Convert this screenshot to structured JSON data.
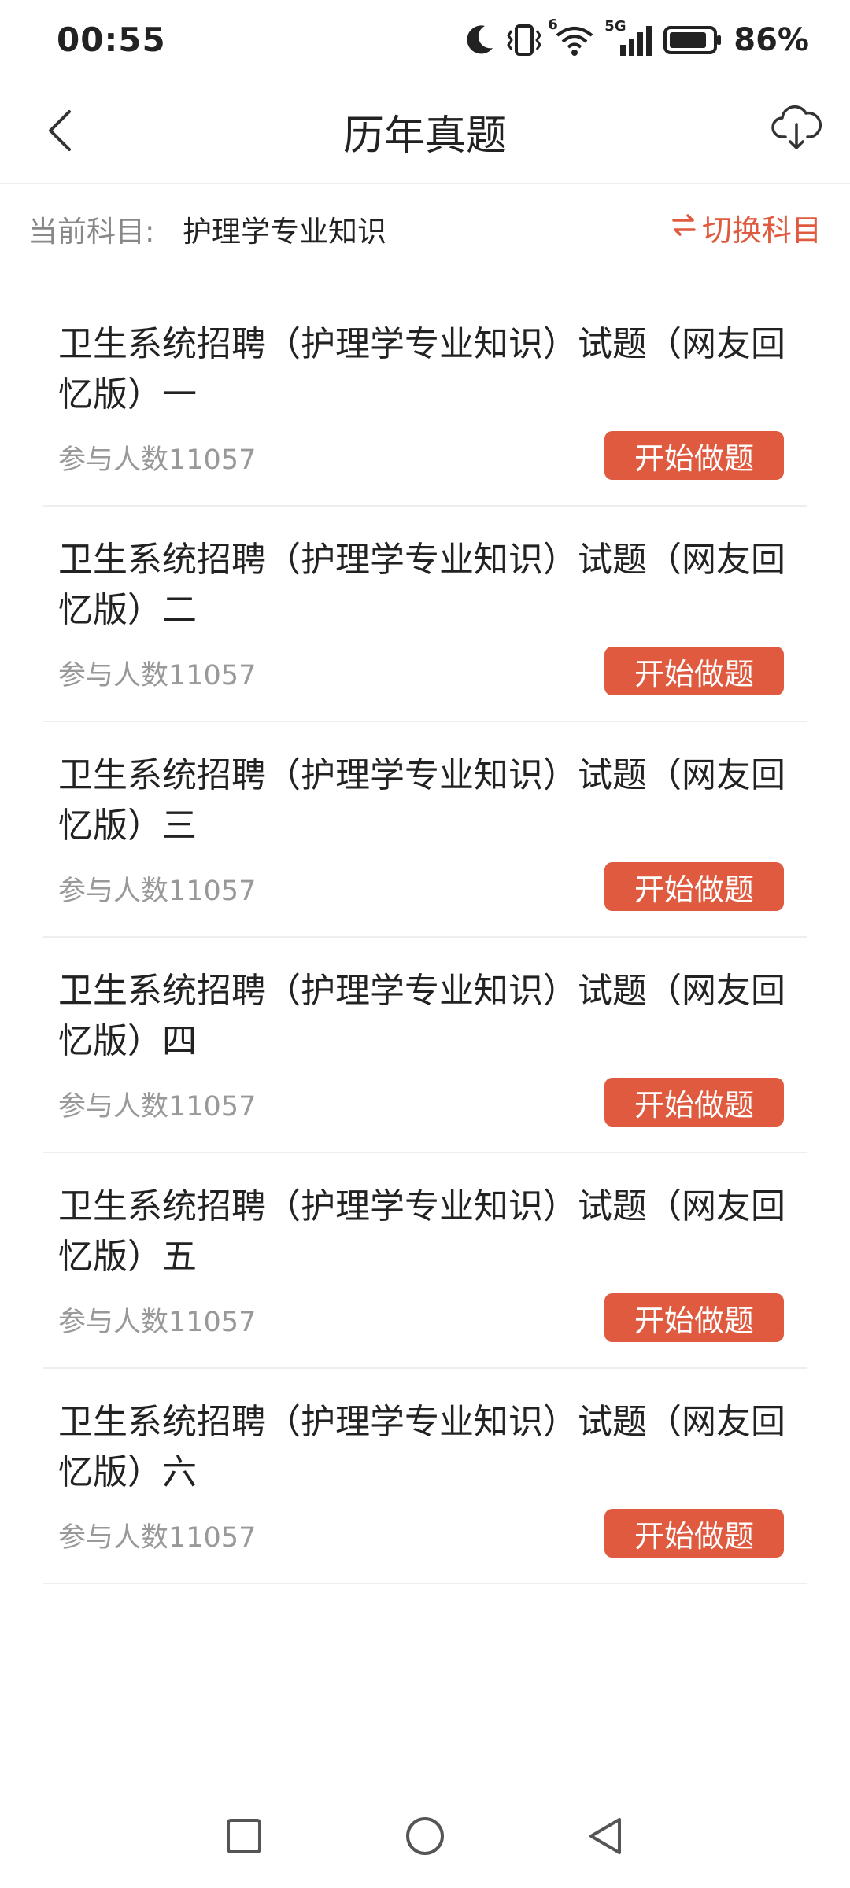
{
  "status_bar": {
    "time": "00:55",
    "battery_percent": "86%",
    "icons": [
      "moon-icon",
      "vibrate-icon",
      "wifi-icon",
      "signal-5g-icon",
      "battery-icon"
    ],
    "wifi_badge": "6",
    "network_badge": "5G"
  },
  "header": {
    "title": "历年真题",
    "back_icon": "chevron-left-icon",
    "download_icon": "cloud-download-icon"
  },
  "subject": {
    "label": "当前科目:",
    "value": "护理学专业知识",
    "switch_label": "切换科目",
    "switch_icon": "swap-arrows-icon"
  },
  "exams": [
    {
      "title": "卫生系统招聘（护理学专业知识）试题（网友回忆版）一",
      "participants": "参与人数11057",
      "button": "开始做题"
    },
    {
      "title": "卫生系统招聘（护理学专业知识）试题（网友回忆版）二",
      "participants": "参与人数11057",
      "button": "开始做题"
    },
    {
      "title": "卫生系统招聘（护理学专业知识）试题（网友回忆版）三",
      "participants": "参与人数11057",
      "button": "开始做题"
    },
    {
      "title": "卫生系统招聘（护理学专业知识）试题（网友回忆版）四",
      "participants": "参与人数11057",
      "button": "开始做题"
    },
    {
      "title": "卫生系统招聘（护理学专业知识）试题（网友回忆版）五",
      "participants": "参与人数11057",
      "button": "开始做题"
    },
    {
      "title": "卫生系统招聘（护理学专业知识）试题（网友回忆版）六",
      "participants": "参与人数11057",
      "button": "开始做题"
    }
  ],
  "nav_bar": {
    "icons": [
      "recent-apps-icon",
      "home-icon",
      "back-icon"
    ]
  },
  "colors": {
    "accent": "#e05a3f",
    "text_primary": "#222222",
    "text_secondary": "#999999",
    "divider": "#eeeeee"
  }
}
